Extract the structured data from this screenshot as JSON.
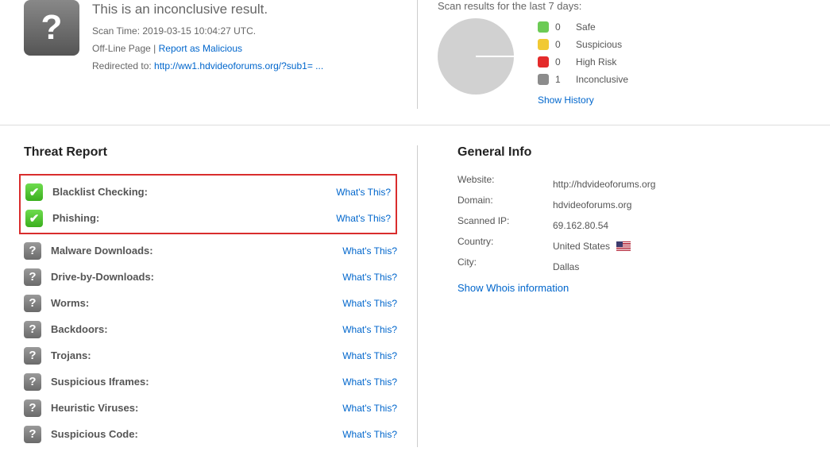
{
  "header": {
    "title": "This is an inconclusive result.",
    "scan_time_label": "Scan Time: ",
    "scan_time": "2019-03-15 10:04:27 UTC.",
    "offline_label": "Off-Line Page | ",
    "report_link": "Report as Malicious",
    "redirect_label": "Redirected to:  ",
    "redirect_url": "http://ww1.hdvideoforums.org/?sub1= ..."
  },
  "scan7": {
    "title": "Scan results for the last 7 days:",
    "items": [
      {
        "count": 0,
        "label": "Safe"
      },
      {
        "count": 0,
        "label": "Suspicious"
      },
      {
        "count": 0,
        "label": "High Risk"
      },
      {
        "count": 1,
        "label": "Inconclusive"
      }
    ],
    "show_history": "Show History"
  },
  "threat": {
    "title": "Threat Report",
    "whats": "What's This?",
    "rows": [
      {
        "label": "Blacklist Checking:",
        "status": "ok"
      },
      {
        "label": "Phishing:",
        "status": "ok"
      },
      {
        "label": "Malware Downloads:",
        "status": "unk"
      },
      {
        "label": "Drive-by-Downloads:",
        "status": "unk"
      },
      {
        "label": "Worms:",
        "status": "unk"
      },
      {
        "label": "Backdoors:",
        "status": "unk"
      },
      {
        "label": "Trojans:",
        "status": "unk"
      },
      {
        "label": "Suspicious Iframes:",
        "status": "unk"
      },
      {
        "label": "Heuristic Viruses:",
        "status": "unk"
      },
      {
        "label": "Suspicious Code:",
        "status": "unk"
      }
    ]
  },
  "general": {
    "title": "General Info",
    "rows": {
      "website_label": "Website:",
      "website_value": "http://hdvideoforums.org",
      "domain_label": "Domain:",
      "domain_value": "hdvideoforums.org",
      "ip_label": "Scanned IP:",
      "ip_value": "69.162.80.54",
      "country_label": "Country:",
      "country_value": "United States",
      "city_label": "City:",
      "city_value": "Dallas"
    },
    "whois": "Show Whois information"
  }
}
